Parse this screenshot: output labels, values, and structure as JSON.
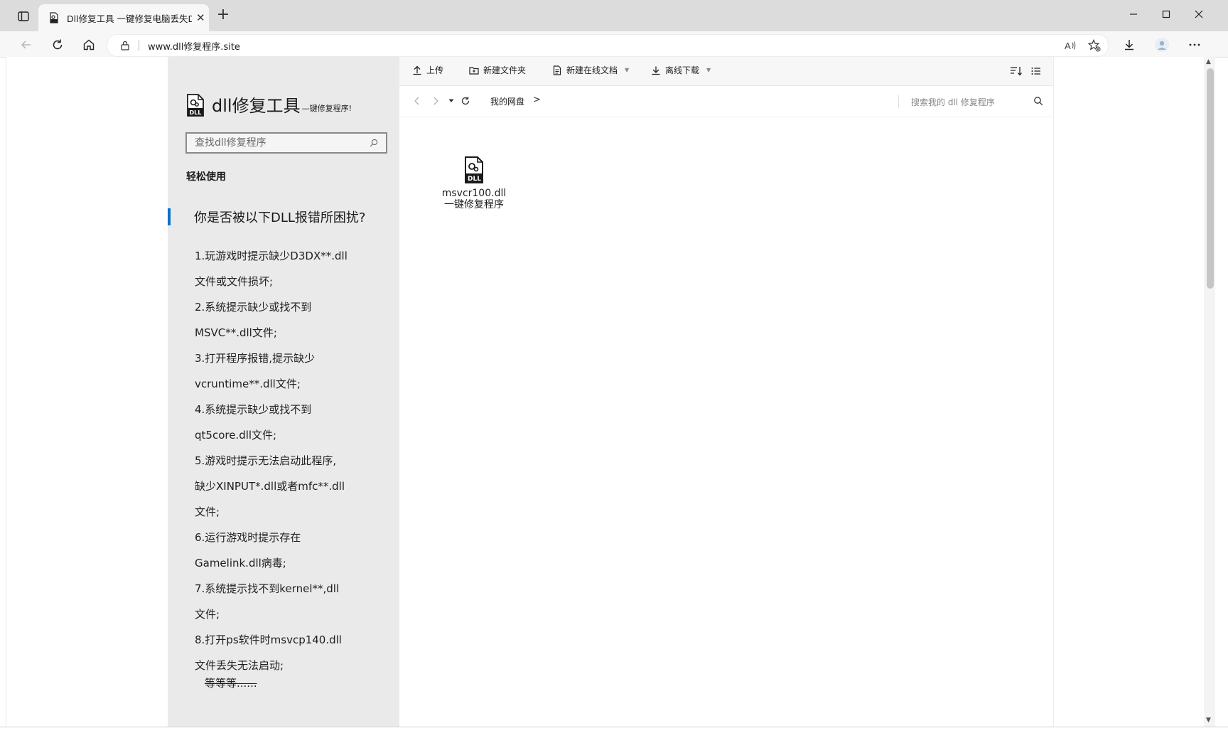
{
  "browser": {
    "tab_title": "Dll修复工具 一键修复电脑丢失Dll文件",
    "url": "www.dll修复程序.site"
  },
  "sidebar": {
    "brand_title": "dll修复工具",
    "brand_subtitle": "—键修复程序!",
    "search_placeholder": "查找dll修复程序",
    "easy_use": "轻松使用",
    "question": "你是否被以下DLL报错所困扰?",
    "issues": [
      "1.玩游戏时提示缺少D3DX**.dll",
      "文件或文件损坏;",
      "2.系统提示缺少或找不到",
      "MSVC**.dll文件;",
      "3.打开程序报错,提示缺少",
      "vcruntime**.dll文件;",
      "4.系统提示缺少或找不到",
      "qt5core.dll文件;",
      "5.游戏时提示无法启动此程序,",
      "缺少XINPUT*.dll或者mfc**.dll",
      "文件;",
      "6.运行游戏时提示存在",
      "Gamelink.dll病毒;",
      "7.系统提示找不到kernel**,dll",
      "文件;",
      "8.打开ps软件时msvcp140.dll",
      "文件丢失无法启动;"
    ],
    "etc": "等等等......"
  },
  "filepanel": {
    "commands": {
      "upload": "上传",
      "new_folder": "新建文件夹",
      "new_doc": "新建在线文档",
      "offline_download": "离线下载"
    },
    "breadcrumb": "我的网盘",
    "breadcrumb_sep": ">",
    "search_placeholder": "搜索我的 dll 修复程序",
    "file": {
      "name_line1": "msvcr100.dll",
      "name_line2": "一键修复程序"
    }
  },
  "icons": {
    "tab_actions": "tab-actions-icon",
    "favicon": "dll-file-icon",
    "close_tab": "close-icon",
    "new_tab": "plus-icon",
    "minimize": "minimize-icon",
    "maximize": "maximize-icon",
    "close_window": "close-icon",
    "back": "back-arrow-icon",
    "refresh": "refresh-icon",
    "home": "home-icon",
    "lock": "lock-icon",
    "read_aloud": "read-aloud-icon",
    "favorites": "add-favorite-icon",
    "downloads": "download-icon",
    "profile": "profile-icon",
    "more": "more-icon"
  },
  "colors": {
    "accent": "#0f6fc6",
    "sidebar_bg": "#eaeaea",
    "chrome_bg": "#dcdcdc"
  }
}
